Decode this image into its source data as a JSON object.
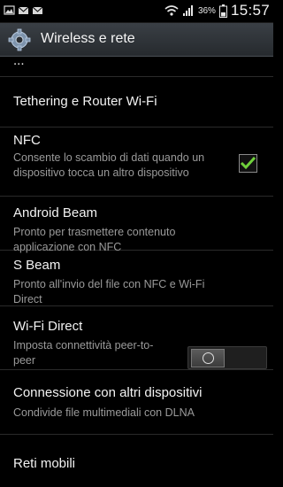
{
  "status_bar": {
    "icons": [
      "photo-icon",
      "missed-message-icon",
      "missed-message-icon",
      "wifi-icon",
      "signal-icon",
      "battery-icon"
    ],
    "battery": "36%",
    "time": "15:57"
  },
  "action_bar": {
    "icon": "gear-icon",
    "title": "Wireless e rete"
  },
  "settings": {
    "partial_item": "...",
    "tethering": {
      "title": "Tethering e Router Wi-Fi"
    },
    "nfc": {
      "title": "NFC",
      "summary": "Consente lo scambio di dati quando un dispositivo tocca un altro dispositivo",
      "checked": true,
      "accent": "#6fd13b"
    },
    "android_beam": {
      "title": "Android Beam",
      "summary": "Pronto per trasmettere contenuto applicazione con NFC"
    },
    "s_beam": {
      "title": "S Beam",
      "summary": "Pronto all'invio del file con NFC e Wi-Fi Direct"
    },
    "wifi_direct": {
      "title": "Wi-Fi Direct",
      "summary": "Imposta connettività peer-to-peer",
      "toggle_on": false
    },
    "other_devices": {
      "title": "Connessione con altri dispositivi",
      "summary": "Condivide file multimediali con DLNA"
    },
    "mobile_networks": {
      "title": "Reti mobili"
    }
  }
}
